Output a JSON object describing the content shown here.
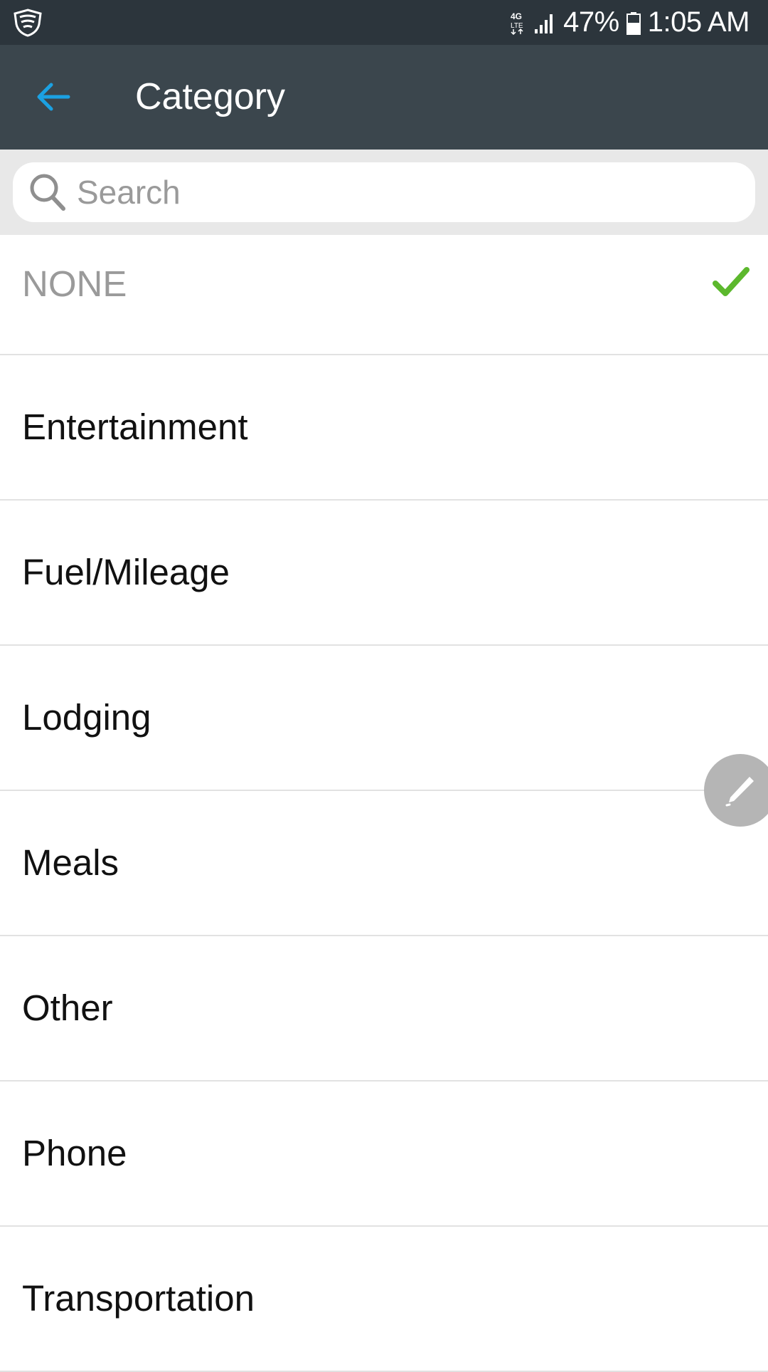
{
  "status_bar": {
    "network": "4G LTE",
    "battery": "47%",
    "time": "1:05 AM"
  },
  "header": {
    "title": "Category",
    "back_icon": "arrow-left-icon"
  },
  "search": {
    "placeholder": "Search",
    "value": ""
  },
  "categories": [
    {
      "label": "NONE",
      "selected": true
    },
    {
      "label": "Entertainment",
      "selected": false
    },
    {
      "label": "Fuel/Mileage",
      "selected": false
    },
    {
      "label": "Lodging",
      "selected": false
    },
    {
      "label": "Meals",
      "selected": false
    },
    {
      "label": "Other",
      "selected": false
    },
    {
      "label": "Phone",
      "selected": false
    },
    {
      "label": "Transportation",
      "selected": false
    }
  ],
  "fab": {
    "icon": "pencil-icon"
  },
  "colors": {
    "status_bar_bg": "#2c353c",
    "app_bar_bg": "#3b464d",
    "accent": "#1ba1e2",
    "check": "#5cb82d",
    "fab_bg": "#b5b5b5"
  }
}
